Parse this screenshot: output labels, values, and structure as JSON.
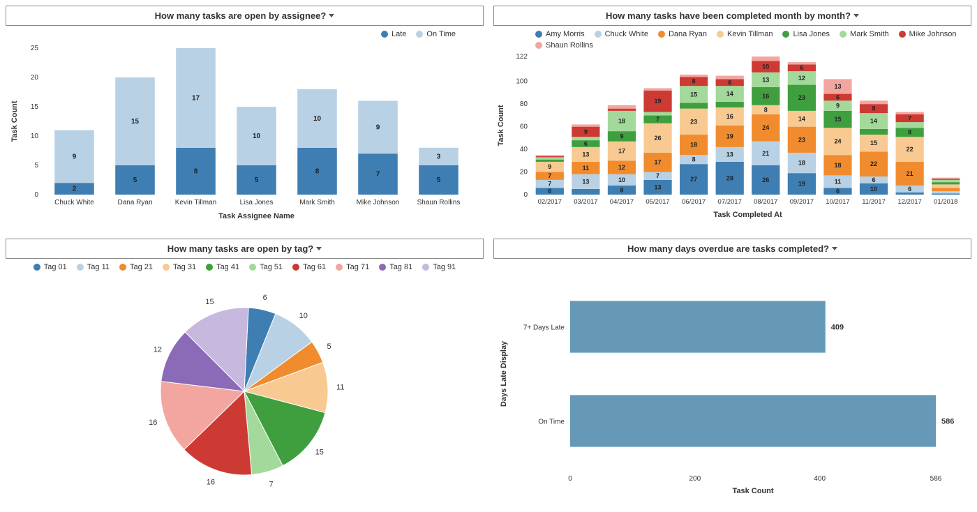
{
  "panels": {
    "a": {
      "title": "How many tasks are open by assignee?"
    },
    "b": {
      "title": "How many tasks have been completed month by month?"
    },
    "c": {
      "title": "How many tasks are open by tag?"
    },
    "d": {
      "title": "How many days overdue are tasks completed?"
    }
  },
  "chart_data": [
    {
      "type": "bar",
      "title": "How many tasks are open by assignee?",
      "xlabel": "Task Assignee Name",
      "ylabel": "Task Count",
      "ylim": [
        0,
        25
      ],
      "categories": [
        "Chuck White",
        "Dana Ryan",
        "Kevin Tillman",
        "Lisa Jones",
        "Mark Smith",
        "Mike Johnson",
        "Shaun Rollins"
      ],
      "series": [
        {
          "name": "Late",
          "color": "#3e7eb2",
          "values": [
            2,
            5,
            8,
            5,
            8,
            7,
            5
          ]
        },
        {
          "name": "On Time",
          "color": "#b8d1e5",
          "values": [
            9,
            15,
            17,
            10,
            10,
            9,
            3
          ]
        }
      ]
    },
    {
      "type": "bar",
      "title": "How many tasks have been completed month by month?",
      "xlabel": "Task Completed At",
      "ylabel": "Task Count",
      "ylim": [
        0,
        122
      ],
      "categories": [
        "02/2017",
        "03/2017",
        "04/2017",
        "05/2017",
        "06/2017",
        "07/2017",
        "08/2017",
        "09/2017",
        "10/2017",
        "11/2017",
        "12/2017",
        "01/2018"
      ],
      "series": [
        {
          "name": "Amy Morris",
          "color": "#3e7eb2",
          "values": [
            6,
            5,
            8,
            13,
            27,
            29,
            26,
            19,
            6,
            10,
            2,
            1
          ]
        },
        {
          "name": "Chuck White",
          "color": "#b8d1e5",
          "values": [
            7,
            13,
            10,
            7,
            8,
            13,
            21,
            18,
            11,
            6,
            6,
            2
          ]
        },
        {
          "name": "Dana Ryan",
          "color": "#f08c2e",
          "values": [
            7,
            11,
            12,
            17,
            18,
            19,
            24,
            23,
            18,
            22,
            21,
            3
          ]
        },
        {
          "name": "Kevin Tillman",
          "color": "#f8c991",
          "values": [
            9,
            13,
            17,
            26,
            23,
            16,
            8,
            14,
            24,
            15,
            22,
            3
          ]
        },
        {
          "name": "Lisa Jones",
          "color": "#3f9f3f",
          "values": [
            2,
            6,
            9,
            7,
            5,
            5,
            16,
            23,
            15,
            5,
            8,
            2
          ]
        },
        {
          "name": "Mark Smith",
          "color": "#a3d99b",
          "values": [
            2,
            3,
            18,
            3,
            15,
            14,
            13,
            12,
            9,
            14,
            5,
            2
          ]
        },
        {
          "name": "Mike Johnson",
          "color": "#cd3a33",
          "values": [
            1,
            9,
            2,
            19,
            8,
            6,
            10,
            6,
            6,
            8,
            7,
            1
          ]
        },
        {
          "name": "Shaun Rollins",
          "color": "#f3a6a0",
          "values": [
            1,
            2,
            3,
            2,
            2,
            3,
            4,
            2,
            13,
            3,
            2,
            1
          ]
        }
      ]
    },
    {
      "type": "pie",
      "title": "How many tasks are open by tag?",
      "series": [
        {
          "name": "Tag 01",
          "color": "#3e7eb2",
          "value": 6
        },
        {
          "name": "Tag 11",
          "color": "#b8d1e5",
          "value": 10
        },
        {
          "name": "Tag 21",
          "color": "#f08c2e",
          "value": 5
        },
        {
          "name": "Tag 31",
          "color": "#f8c991",
          "value": 11
        },
        {
          "name": "Tag 41",
          "color": "#3f9f3f",
          "value": 15
        },
        {
          "name": "Tag 51",
          "color": "#a3d99b",
          "value": 7
        },
        {
          "name": "Tag 61",
          "color": "#cd3a33",
          "value": 16
        },
        {
          "name": "Tag 71",
          "color": "#f3a6a0",
          "value": 16
        },
        {
          "name": "Tag 81",
          "color": "#8b6bb8",
          "value": 12
        },
        {
          "name": "Tag 91",
          "color": "#c7b8dd",
          "value": 15
        }
      ]
    },
    {
      "type": "bar",
      "orientation": "horizontal",
      "title": "How many days overdue are tasks completed?",
      "xlabel": "Task Count",
      "ylabel": "Days Late Display",
      "xlim": [
        0,
        586
      ],
      "categories": [
        "7+ Days Late",
        "On Time"
      ],
      "values": [
        409,
        586
      ],
      "color": "#6699b8"
    }
  ]
}
